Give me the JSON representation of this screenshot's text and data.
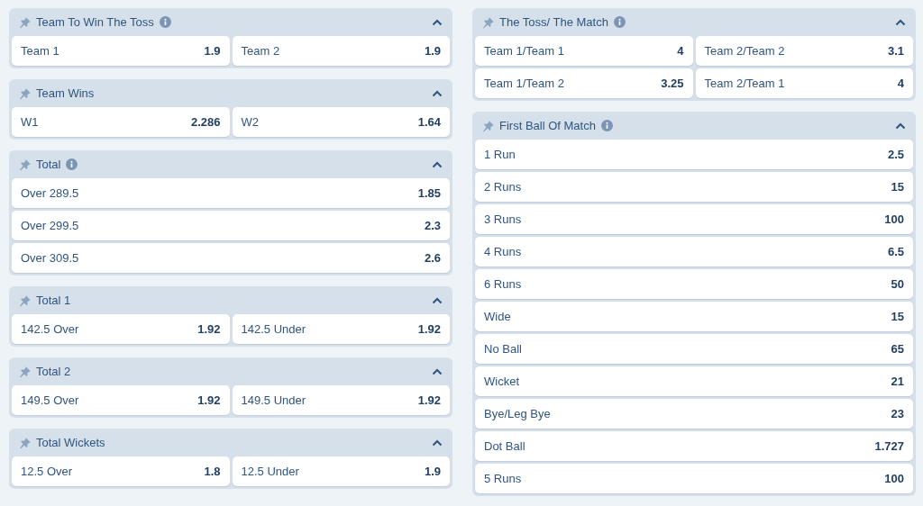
{
  "columns": [
    {
      "panels": [
        {
          "title": "Team To Win The Toss",
          "info": true,
          "expanded": true,
          "kind": "pair",
          "options": [
            {
              "label": "Team 1",
              "odds": "1.9"
            },
            {
              "label": "Team 2",
              "odds": "1.9"
            }
          ]
        },
        {
          "title": "Team Wins",
          "info": false,
          "expanded": true,
          "kind": "pair",
          "options": [
            {
              "label": "W1",
              "odds": "2.286"
            },
            {
              "label": "W2",
              "odds": "1.64"
            }
          ]
        },
        {
          "title": "Total",
          "info": true,
          "expanded": true,
          "kind": "list",
          "options": [
            {
              "label": "Over 289.5",
              "odds": "1.85"
            },
            {
              "label": "Over 299.5",
              "odds": "2.3"
            },
            {
              "label": "Over 309.5",
              "odds": "2.6"
            }
          ]
        },
        {
          "title": "Total 1",
          "info": false,
          "expanded": true,
          "kind": "pair",
          "options": [
            {
              "label": "142.5 Over",
              "odds": "1.92"
            },
            {
              "label": "142.5 Under",
              "odds": "1.92"
            }
          ]
        },
        {
          "title": "Total 2",
          "info": false,
          "expanded": true,
          "kind": "pair",
          "options": [
            {
              "label": "149.5 Over",
              "odds": "1.92"
            },
            {
              "label": "149.5 Under",
              "odds": "1.92"
            }
          ]
        },
        {
          "title": "Total Wickets",
          "info": false,
          "expanded": true,
          "kind": "pair",
          "options": [
            {
              "label": "12.5 Over",
              "odds": "1.8"
            },
            {
              "label": "12.5 Under",
              "odds": "1.9"
            }
          ]
        }
      ]
    },
    {
      "panels": [
        {
          "title": "The Toss/ The Match",
          "info": true,
          "expanded": true,
          "kind": "pair",
          "options": [
            {
              "label": "Team 1/Team 1",
              "odds": "4"
            },
            {
              "label": "Team 2/Team 2",
              "odds": "3.1"
            },
            {
              "label": "Team 1/Team 2",
              "odds": "3.25"
            },
            {
              "label": "Team 2/Team 1",
              "odds": "4"
            }
          ]
        },
        {
          "title": "First Ball Of Match",
          "info": true,
          "expanded": true,
          "kind": "list",
          "options": [
            {
              "label": "1 Run",
              "odds": "2.5"
            },
            {
              "label": "2 Runs",
              "odds": "15"
            },
            {
              "label": "3 Runs",
              "odds": "100"
            },
            {
              "label": "4 Runs",
              "odds": "6.5"
            },
            {
              "label": "6 Runs",
              "odds": "50"
            },
            {
              "label": "Wide",
              "odds": "15"
            },
            {
              "label": "No Ball",
              "odds": "65"
            },
            {
              "label": "Wicket",
              "odds": "21"
            },
            {
              "label": "Bye/Leg Bye",
              "odds": "23"
            },
            {
              "label": "Dot Ball",
              "odds": "1.727"
            },
            {
              "label": "5 Runs",
              "odds": "100"
            }
          ]
        }
      ]
    }
  ]
}
